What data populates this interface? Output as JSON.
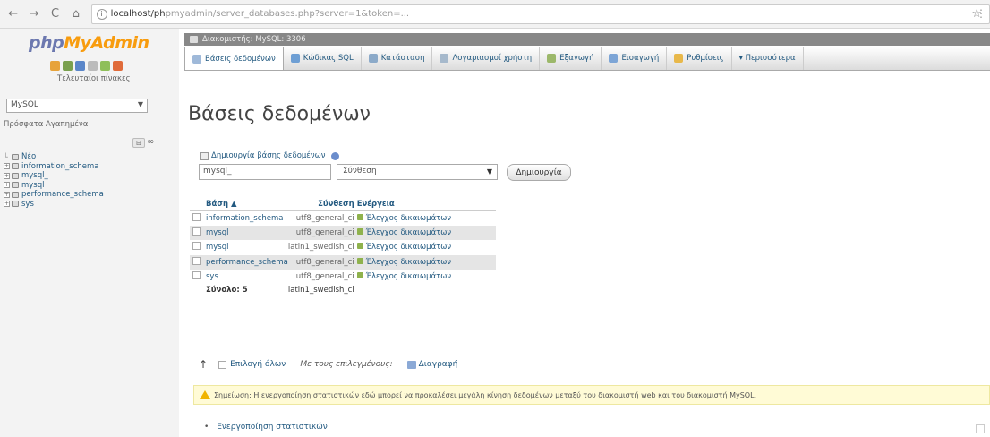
{
  "browser": {
    "back": "←",
    "forward": "→",
    "reload": "C",
    "home": "⌂",
    "url_host": "localhost/ph",
    "url_path": "pmyadmin/server_databases.php?server=1&token=...",
    "star": "☆",
    "menu": "⋮"
  },
  "left": {
    "logo_php": "php",
    "logo_myadmin": "MyAdmin",
    "recent_label": "Τελευταίοι πίνακες",
    "server_select": "MySQL",
    "recent_favorites": "Πρόσφατα  Αγαπημένα",
    "collapse": "⊟",
    "link": "∞",
    "tree": [
      {
        "label": "Νέο",
        "expander": false
      },
      {
        "label": "information_schema",
        "expander": true
      },
      {
        "label": "mysql_",
        "expander": true
      },
      {
        "label": "mysql",
        "expander": true
      },
      {
        "label": "performance_schema",
        "expander": true
      },
      {
        "label": "sys",
        "expander": true
      }
    ],
    "quick_icon_colors": [
      "#e7a33a",
      "#7aa04e",
      "#5a86c9",
      "#bbbbbb",
      "#8fbf5a",
      "#e06b3a"
    ]
  },
  "main": {
    "server_label": "Διακομιστής: MySQL: 3306",
    "tabs": [
      {
        "label": "Βάσεις δεδομένων",
        "icon_color": "#9fb9d9",
        "active": true
      },
      {
        "label": "Κώδικας SQL",
        "icon_color": "#6e9fd4",
        "active": false
      },
      {
        "label": "Κατάσταση",
        "icon_color": "#8caac9",
        "active": false
      },
      {
        "label": "Λογαριασμοί χρήστη",
        "icon_color": "#a6b9cc",
        "active": false
      },
      {
        "label": "Εξαγωγή",
        "icon_color": "#9cb86a",
        "active": false
      },
      {
        "label": "Εισαγωγή",
        "icon_color": "#7da5d6",
        "active": false
      },
      {
        "label": "Ρυθμίσεις",
        "icon_color": "#e8b84a",
        "active": false
      },
      {
        "label": "▾ Περισσότερα",
        "icon_color": "",
        "active": false
      }
    ],
    "title": "Βάσεις δεδομένων",
    "create_label": "Δημιουργία βάσης δεδομένων",
    "db_name_value": "mysql_",
    "collation_value": "Σύνθεση",
    "create_button": "Δημιουργία",
    "table": {
      "headers": [
        "Βάση ▲",
        "Σύνθεση",
        "Ενέργεια"
      ],
      "rows": [
        {
          "name": "information_schema",
          "collation": "utf8_general_ci",
          "action": "Έλεγχος δικαιωμάτων"
        },
        {
          "name": "mysql",
          "collation": "utf8_general_ci",
          "action": "Έλεγχος δικαιωμάτων"
        },
        {
          "name": "mysql",
          "collation": "latin1_swedish_ci",
          "action": "Έλεγχος δικαιωμάτων"
        },
        {
          "name": "performance_schema",
          "collation": "utf8_general_ci",
          "action": "Έλεγχος δικαιωμάτων"
        },
        {
          "name": "sys",
          "collation": "utf8_general_ci",
          "action": "Έλεγχος δικαιωμάτων"
        }
      ],
      "total_label": "Σύνολο: 5",
      "total_collation": "latin1_swedish_ci"
    },
    "with_selected": {
      "arrow": "↑",
      "check_all": "Επιλογή όλων",
      "with_selected": "Με τους επιλεγμένους:",
      "drop": "Διαγραφή"
    },
    "notice": "Σημείωση: Η ενεργοποίηση στατιστικών εδώ μπορεί να προκαλέσει μεγάλη κίνηση δεδομένων μεταξύ του διακομιστή web και του διακομιστή MySQL.",
    "enable_stats": "Ενεργοποίηση στατιστικών"
  }
}
